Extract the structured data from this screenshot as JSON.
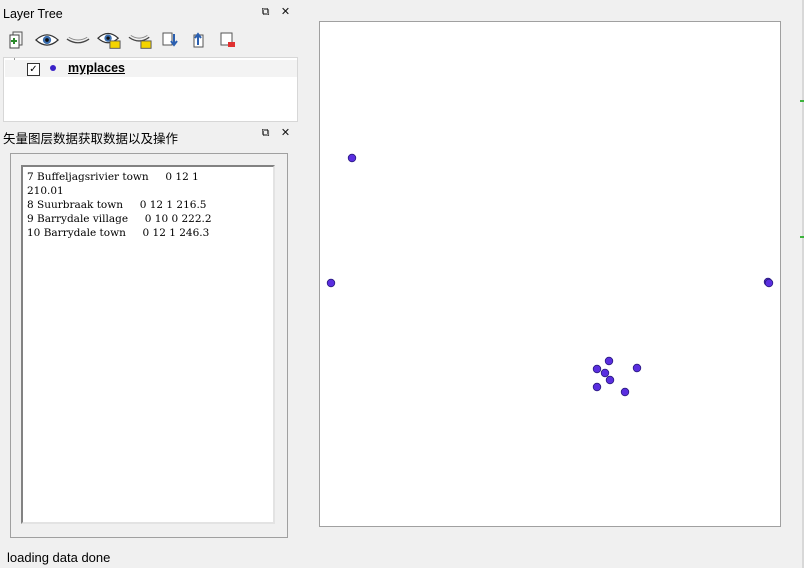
{
  "layer_tree": {
    "title": "Layer Tree",
    "float_icon": "⧉",
    "close_icon": "✕",
    "toolbar": [
      {
        "name": "add-layer-icon"
      },
      {
        "name": "show-all-layers-icon"
      },
      {
        "name": "hide-all-layers-icon"
      },
      {
        "name": "show-selected-layers-icon"
      },
      {
        "name": "hide-selected-layers-icon"
      },
      {
        "name": "move-layer-down-icon"
      },
      {
        "name": "move-layer-up-icon"
      },
      {
        "name": "remove-layer-icon"
      }
    ],
    "layers": [
      {
        "name": "myplaces",
        "checked": "✓",
        "symbol_color": "#3a22c8"
      }
    ]
  },
  "vector_panel": {
    "title": "矢量图层数据获取数据以及操作",
    "float_icon": "⧉",
    "close_icon": "✕",
    "text": "7 Buffeljagsrivier town     0 12 1\n210.01\n8 Suurbraak town     0 12 1 216.5\n9 Barrydale village     0 10 0 222.2\n10 Barrydale town     0 12 1 246.3"
  },
  "map": {
    "point_color": "#5a2ee0",
    "point_stroke": "#2a1a80"
  },
  "status_bar": {
    "message": "loading data done"
  }
}
